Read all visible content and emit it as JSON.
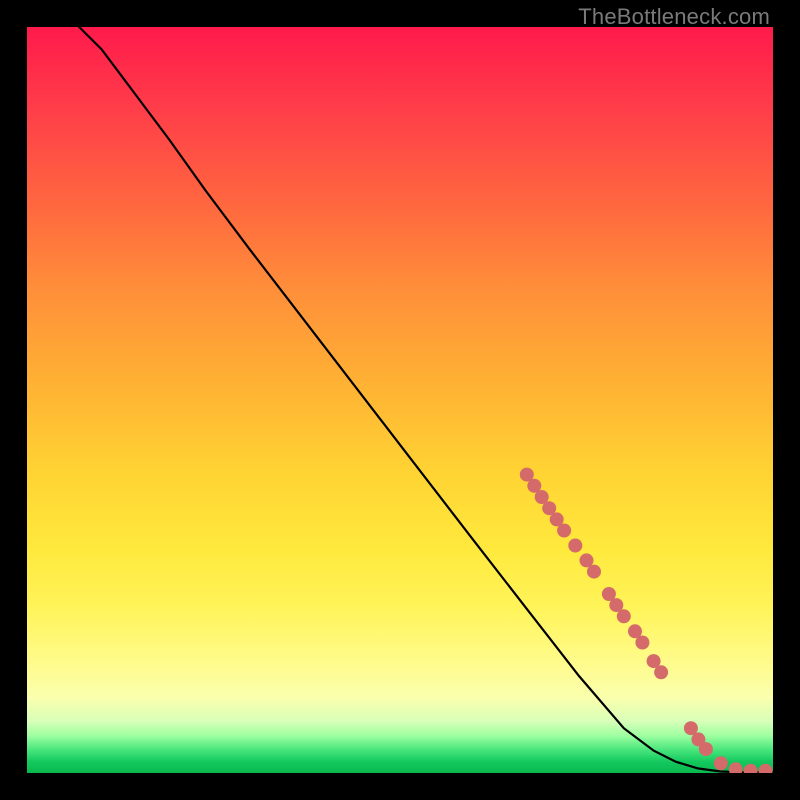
{
  "watermark": "TheBottleneck.com",
  "chart_data": {
    "type": "line",
    "title": "",
    "xlabel": "",
    "ylabel": "",
    "xlim": [
      0,
      100
    ],
    "ylim": [
      0,
      100
    ],
    "grid": false,
    "series": [
      {
        "name": "curve",
        "x": [
          7,
          10,
          13,
          16,
          19,
          24,
          30,
          40,
          50,
          60,
          67,
          74,
          80,
          84,
          87,
          90,
          93,
          96,
          100
        ],
        "y": [
          100,
          97,
          93,
          89,
          85,
          78,
          70,
          57,
          44,
          31,
          22,
          13,
          6,
          3,
          1.5,
          0.6,
          0.2,
          0.1,
          0.1
        ]
      }
    ],
    "markers": [
      {
        "x": 67,
        "y": 40
      },
      {
        "x": 68,
        "y": 38.5
      },
      {
        "x": 69,
        "y": 37
      },
      {
        "x": 70,
        "y": 35.5
      },
      {
        "x": 71,
        "y": 34
      },
      {
        "x": 72,
        "y": 32.5
      },
      {
        "x": 73.5,
        "y": 30.5
      },
      {
        "x": 75,
        "y": 28.5
      },
      {
        "x": 76,
        "y": 27
      },
      {
        "x": 78,
        "y": 24
      },
      {
        "x": 79,
        "y": 22.5
      },
      {
        "x": 80,
        "y": 21
      },
      {
        "x": 81.5,
        "y": 19
      },
      {
        "x": 82.5,
        "y": 17.5
      },
      {
        "x": 84,
        "y": 15
      },
      {
        "x": 85,
        "y": 13.5
      },
      {
        "x": 89,
        "y": 6
      },
      {
        "x": 90,
        "y": 4.5
      },
      {
        "x": 91,
        "y": 3.2
      },
      {
        "x": 93,
        "y": 1.3
      },
      {
        "x": 95,
        "y": 0.5
      },
      {
        "x": 97,
        "y": 0.3
      },
      {
        "x": 99,
        "y": 0.3
      }
    ],
    "marker_style": {
      "color": "#d46a6a",
      "radius_px": 7
    }
  }
}
